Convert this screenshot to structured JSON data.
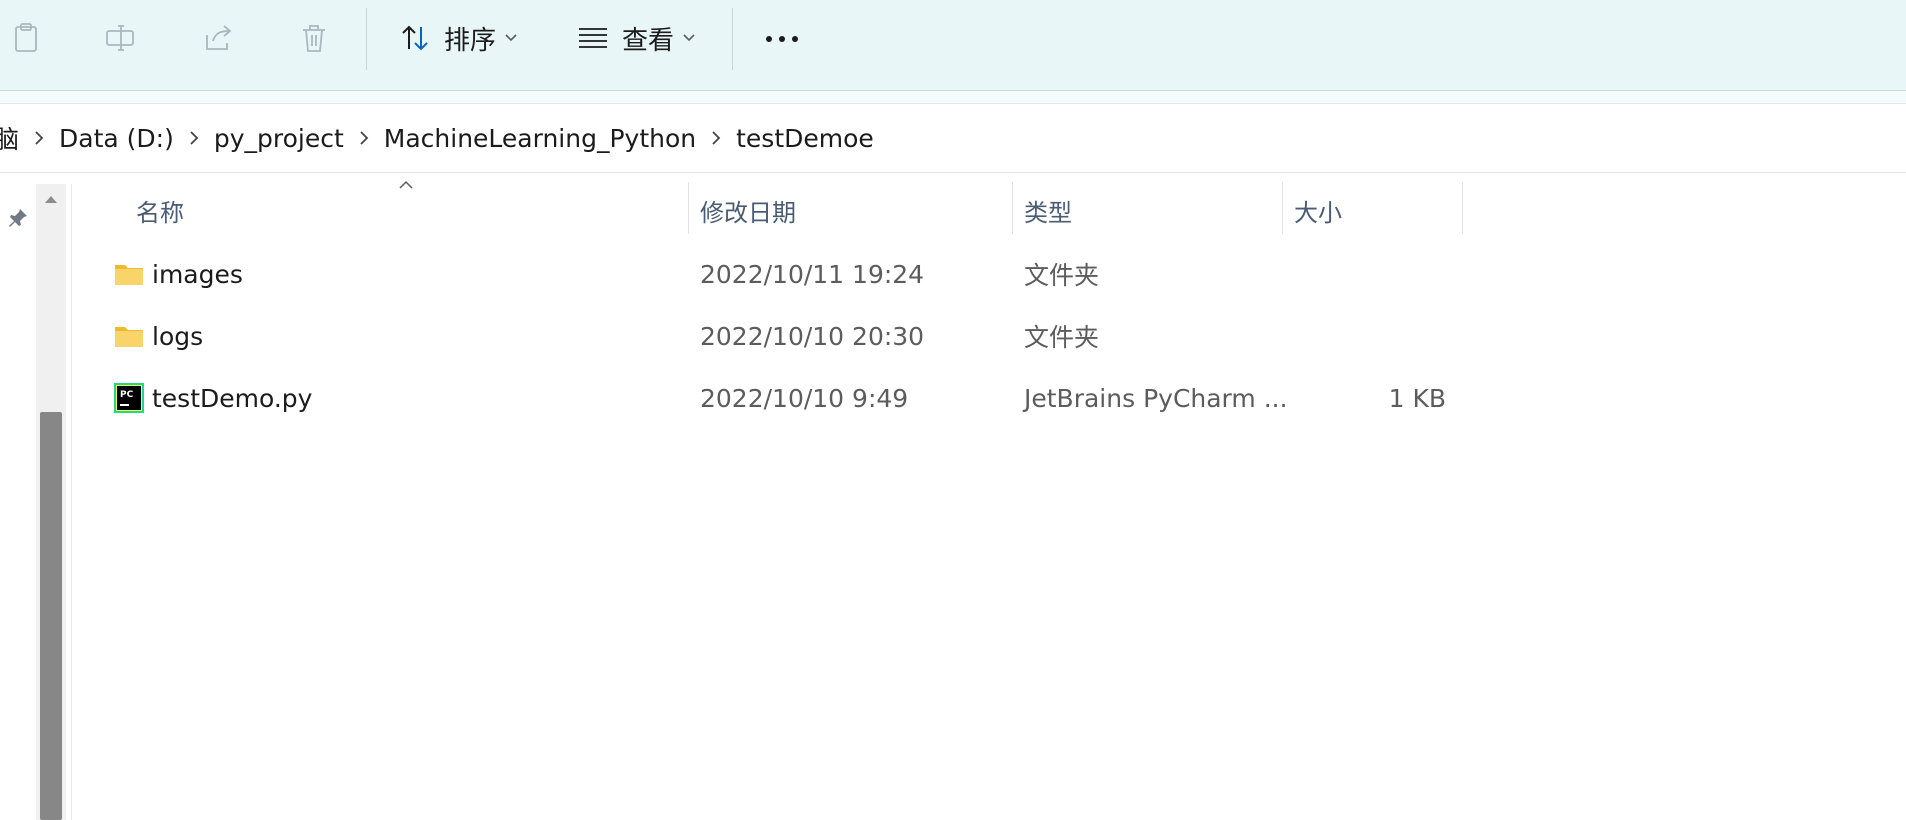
{
  "toolbar": {
    "sort_label": "排序",
    "view_label": "查看",
    "icons": [
      "paste-icon",
      "rename-icon",
      "share-icon",
      "delete-icon",
      "sort-icon",
      "view-icon",
      "more-icon"
    ]
  },
  "breadcrumb": {
    "items": [
      "Data (D:)",
      "py_project",
      "MachineLearning_Python",
      "testDemoe"
    ],
    "partial_first": "脑"
  },
  "columns": {
    "name": "名称",
    "date": "修改日期",
    "type": "类型",
    "size": "大小"
  },
  "rows": [
    {
      "icon": "folder-icon",
      "name": "images",
      "date": "2022/10/11 19:24",
      "type": "文件夹",
      "size": ""
    },
    {
      "icon": "folder-icon",
      "name": "logs",
      "date": "2022/10/10 20:30",
      "type": "文件夹",
      "size": ""
    },
    {
      "icon": "pycharm-file-icon",
      "name": "testDemo.py",
      "date": "2022/10/10 9:49",
      "type": "JetBrains PyCharm ...",
      "size": "1 KB"
    }
  ],
  "colors": {
    "toolbar_bg": "#e8f6f8",
    "header_text": "#4a5b74",
    "folder": "#f6c744",
    "accent": "#0a64c2"
  }
}
